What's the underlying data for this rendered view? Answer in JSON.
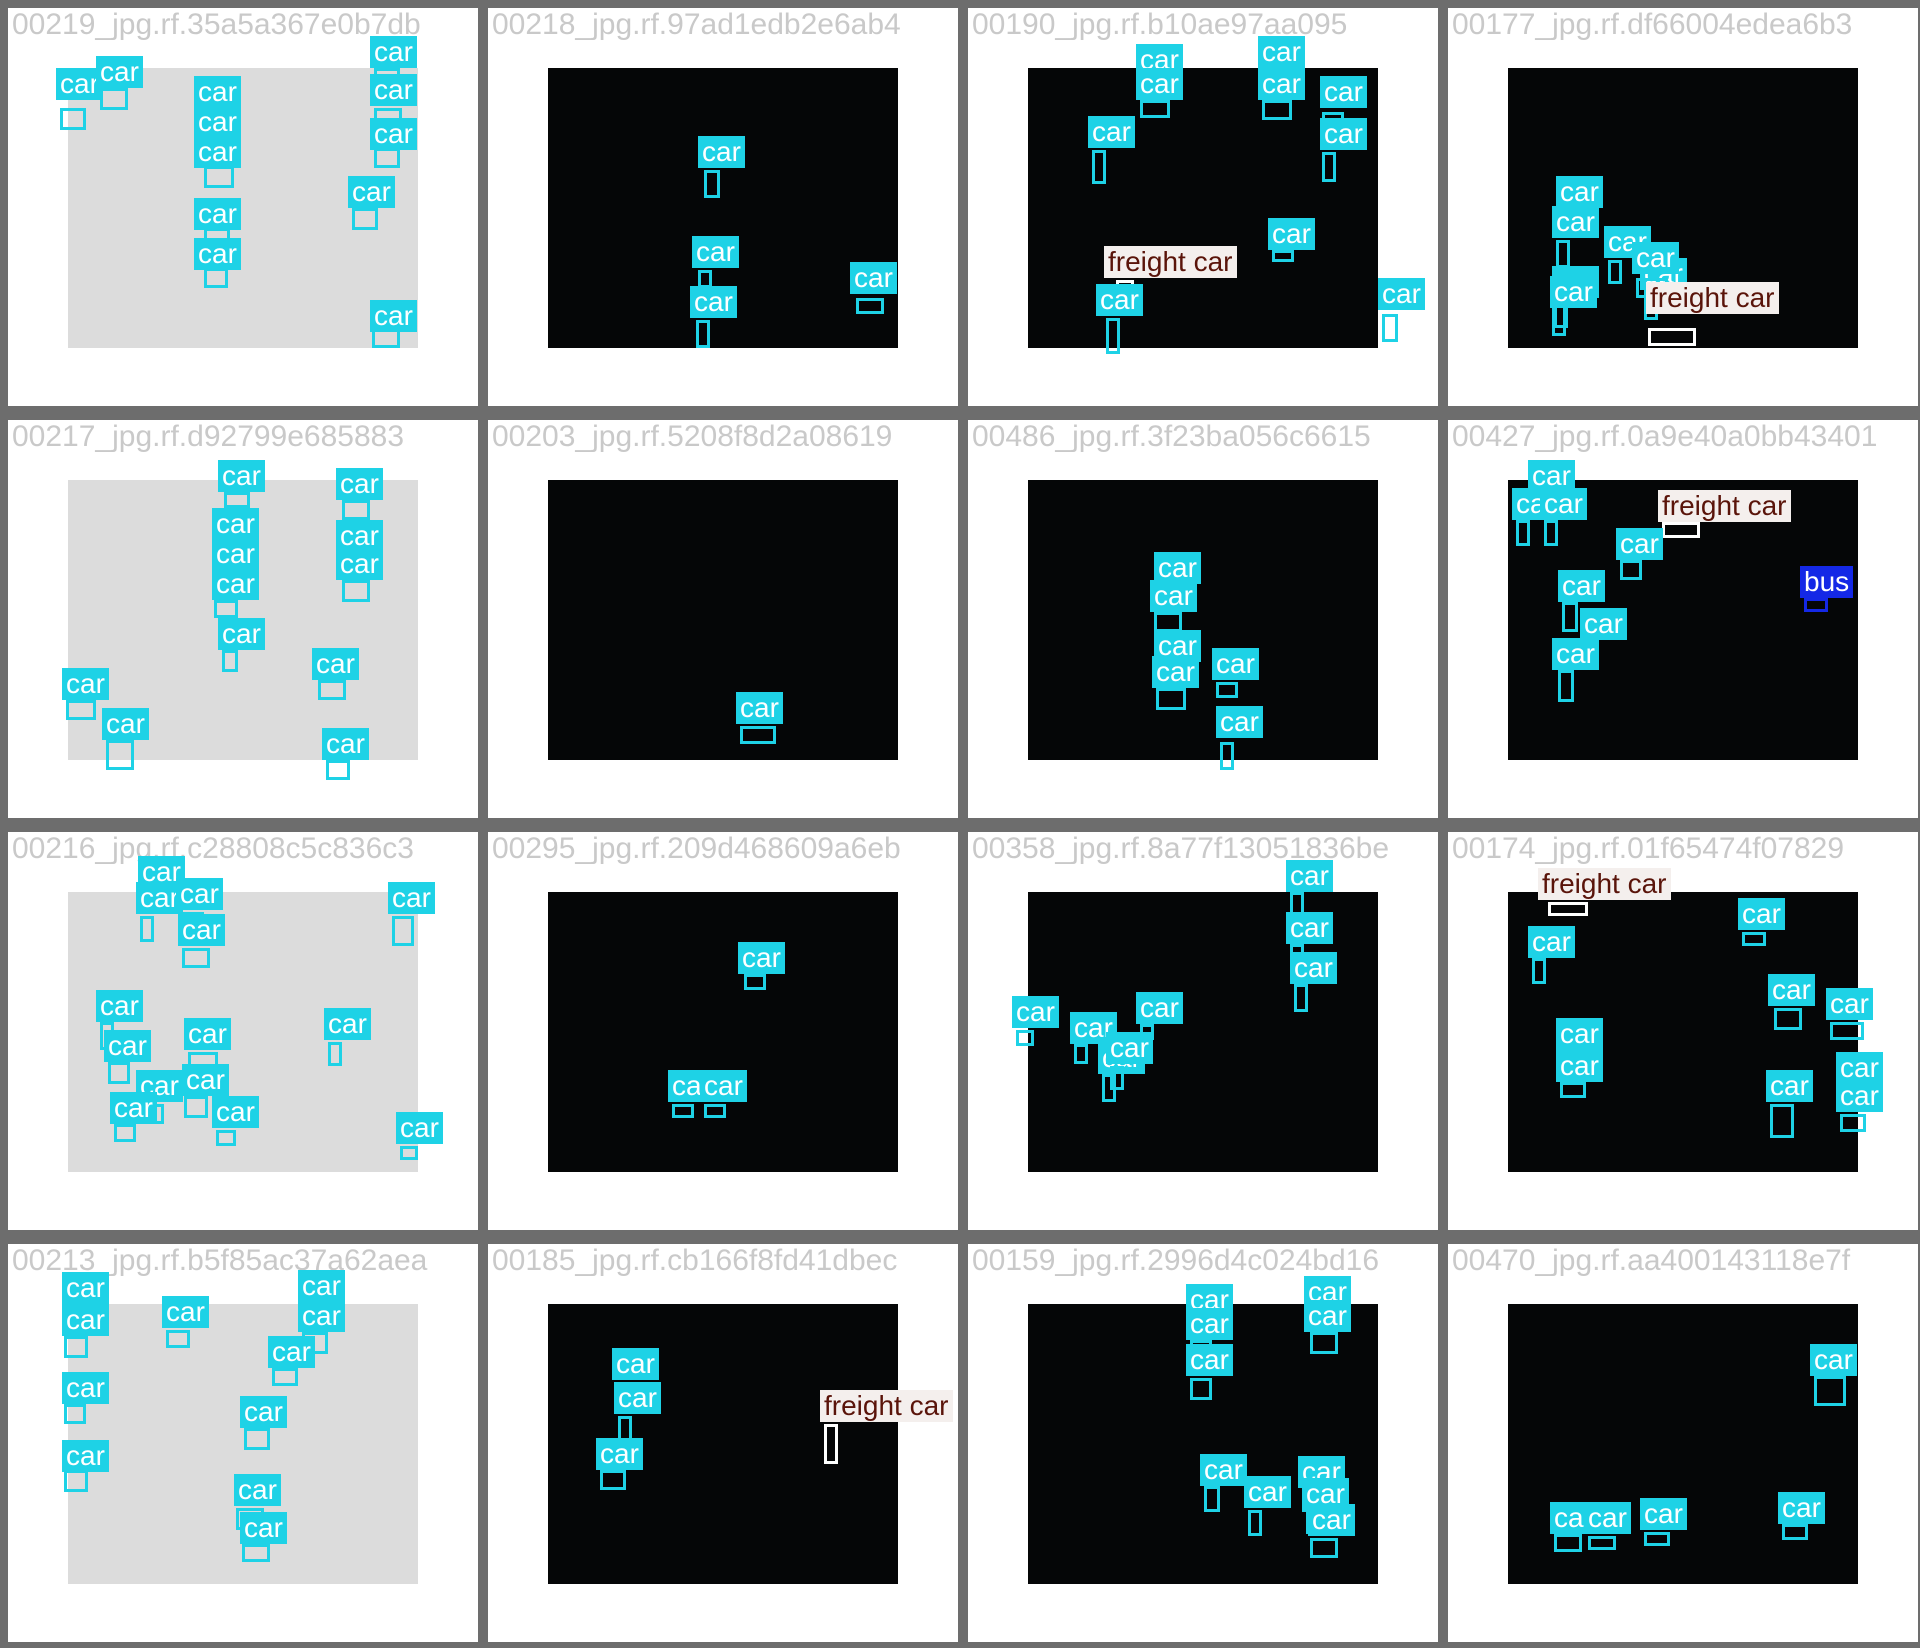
{
  "colors": {
    "car": "#1ed2e6",
    "freight_car": "#f4efed",
    "freight_car_text": "#5a140a",
    "bus": "#1428e6"
  },
  "cells": [
    {
      "caption": "00219_jpg.rf.35a5a367e0b7db",
      "scene": "day",
      "detections": [
        {
          "label": "car",
          "cls": "car"
        },
        {
          "label": "car",
          "cls": "car"
        },
        {
          "label": "car",
          "cls": "car"
        },
        {
          "label": "car",
          "cls": "car"
        },
        {
          "label": "car",
          "cls": "car"
        },
        {
          "label": "car",
          "cls": "car"
        },
        {
          "label": "car",
          "cls": "car"
        },
        {
          "label": "car",
          "cls": "car"
        },
        {
          "label": "car",
          "cls": "car"
        },
        {
          "label": "car",
          "cls": "car"
        },
        {
          "label": "car",
          "cls": "car"
        },
        {
          "label": "car",
          "cls": "car"
        }
      ]
    },
    {
      "caption": "00218_jpg.rf.97ad1edb2e6ab4",
      "scene": "night",
      "detections": [
        {
          "label": "car",
          "cls": "car"
        },
        {
          "label": "car",
          "cls": "car"
        },
        {
          "label": "car",
          "cls": "car"
        },
        {
          "label": "car",
          "cls": "car"
        }
      ]
    },
    {
      "caption": "00190_jpg.rf.b10ae97aa095",
      "scene": "night",
      "detections": [
        {
          "label": "car",
          "cls": "car"
        },
        {
          "label": "car",
          "cls": "car"
        },
        {
          "label": "car",
          "cls": "car"
        },
        {
          "label": "car",
          "cls": "car"
        },
        {
          "label": "car",
          "cls": "car"
        },
        {
          "label": "car",
          "cls": "car"
        },
        {
          "label": "car",
          "cls": "car"
        },
        {
          "label": "car",
          "cls": "car"
        },
        {
          "label": "freight car",
          "cls": "freight"
        },
        {
          "label": "car",
          "cls": "car"
        },
        {
          "label": "car",
          "cls": "car"
        }
      ]
    },
    {
      "caption": "00177_jpg.rf.df66004edea6b3",
      "scene": "night",
      "detections": [
        {
          "label": "car",
          "cls": "car"
        },
        {
          "label": "car",
          "cls": "car"
        },
        {
          "label": "car",
          "cls": "car"
        },
        {
          "label": "car",
          "cls": "car"
        },
        {
          "label": "car",
          "cls": "car"
        },
        {
          "label": "car",
          "cls": "car"
        },
        {
          "label": "car",
          "cls": "car"
        },
        {
          "label": "freight car",
          "cls": "freight"
        }
      ]
    },
    {
      "caption": "00217_jpg.rf.d92799e685883",
      "scene": "day",
      "detections": [
        {
          "label": "car",
          "cls": "car"
        },
        {
          "label": "car",
          "cls": "car"
        },
        {
          "label": "car",
          "cls": "car"
        },
        {
          "label": "car",
          "cls": "car"
        },
        {
          "label": "car",
          "cls": "car"
        },
        {
          "label": "car",
          "cls": "car"
        },
        {
          "label": "car",
          "cls": "car"
        },
        {
          "label": "car",
          "cls": "car"
        },
        {
          "label": "car",
          "cls": "car"
        },
        {
          "label": "car",
          "cls": "car"
        },
        {
          "label": "car",
          "cls": "car"
        },
        {
          "label": "car",
          "cls": "car"
        }
      ]
    },
    {
      "caption": "00203_jpg.rf.5208f8d2a08619",
      "scene": "night",
      "detections": [
        {
          "label": "car",
          "cls": "car"
        }
      ]
    },
    {
      "caption": "00486_jpg.rf.3f23ba056c6615",
      "scene": "night",
      "detections": [
        {
          "label": "car",
          "cls": "car"
        },
        {
          "label": "car",
          "cls": "car"
        },
        {
          "label": "car",
          "cls": "car"
        },
        {
          "label": "car",
          "cls": "car"
        },
        {
          "label": "car",
          "cls": "car"
        },
        {
          "label": "car",
          "cls": "car"
        }
      ]
    },
    {
      "caption": "00427_jpg.rf.0a9e40a0bb43401",
      "scene": "night",
      "detections": [
        {
          "label": "car",
          "cls": "car"
        },
        {
          "label": "car",
          "cls": "car"
        },
        {
          "label": "car",
          "cls": "car"
        },
        {
          "label": "freight car",
          "cls": "freight"
        },
        {
          "label": "car",
          "cls": "car"
        },
        {
          "label": "car",
          "cls": "car"
        },
        {
          "label": "car",
          "cls": "car"
        },
        {
          "label": "bus",
          "cls": "bus"
        },
        {
          "label": "car",
          "cls": "car"
        }
      ]
    },
    {
      "caption": "00216_jpg.rf.c28808c5c836c3",
      "scene": "day",
      "detections": [
        {
          "label": "car",
          "cls": "car"
        },
        {
          "label": "car",
          "cls": "car"
        },
        {
          "label": "car",
          "cls": "car"
        },
        {
          "label": "car",
          "cls": "car"
        },
        {
          "label": "car",
          "cls": "car"
        },
        {
          "label": "car",
          "cls": "car"
        },
        {
          "label": "car",
          "cls": "car"
        },
        {
          "label": "car",
          "cls": "car"
        },
        {
          "label": "car",
          "cls": "car"
        },
        {
          "label": "car",
          "cls": "car"
        },
        {
          "label": "car",
          "cls": "car"
        },
        {
          "label": "car",
          "cls": "car"
        },
        {
          "label": "car",
          "cls": "car"
        },
        {
          "label": "car",
          "cls": "car"
        }
      ]
    },
    {
      "caption": "00295_jpg.rf.209d468609a6eb",
      "scene": "night",
      "detections": [
        {
          "label": "car",
          "cls": "car"
        },
        {
          "label": "car",
          "cls": "car"
        },
        {
          "label": "car",
          "cls": "car"
        }
      ]
    },
    {
      "caption": "00358_jpg.rf.8a77f13051836be",
      "scene": "night",
      "detections": [
        {
          "label": "car",
          "cls": "car"
        },
        {
          "label": "car",
          "cls": "car"
        },
        {
          "label": "car",
          "cls": "car"
        },
        {
          "label": "car",
          "cls": "car"
        },
        {
          "label": "car",
          "cls": "car"
        },
        {
          "label": "car",
          "cls": "car"
        },
        {
          "label": "car",
          "cls": "car"
        },
        {
          "label": "car",
          "cls": "car"
        }
      ]
    },
    {
      "caption": "00174_jpg.rf.01f65474f07829",
      "scene": "night",
      "detections": [
        {
          "label": "freight car",
          "cls": "freight"
        },
        {
          "label": "car",
          "cls": "car"
        },
        {
          "label": "car",
          "cls": "car"
        },
        {
          "label": "car",
          "cls": "car"
        },
        {
          "label": "car",
          "cls": "car"
        },
        {
          "label": "car",
          "cls": "car"
        },
        {
          "label": "car",
          "cls": "car"
        },
        {
          "label": "car",
          "cls": "car"
        },
        {
          "label": "car",
          "cls": "car"
        },
        {
          "label": "car",
          "cls": "car"
        }
      ]
    },
    {
      "caption": "00213_jpg.rf.b5f85ac37a62aea",
      "scene": "day",
      "detections": [
        {
          "label": "car",
          "cls": "car"
        },
        {
          "label": "car",
          "cls": "car"
        },
        {
          "label": "car",
          "cls": "car"
        },
        {
          "label": "car",
          "cls": "car"
        },
        {
          "label": "car",
          "cls": "car"
        },
        {
          "label": "car",
          "cls": "car"
        },
        {
          "label": "car",
          "cls": "car"
        },
        {
          "label": "car",
          "cls": "car"
        },
        {
          "label": "car",
          "cls": "car"
        },
        {
          "label": "car",
          "cls": "car"
        },
        {
          "label": "car",
          "cls": "car"
        }
      ]
    },
    {
      "caption": "00185_jpg.rf.cb166f8fd41dbec",
      "scene": "night",
      "detections": [
        {
          "label": "car",
          "cls": "car"
        },
        {
          "label": "car",
          "cls": "car"
        },
        {
          "label": "car",
          "cls": "car"
        },
        {
          "label": "freight car",
          "cls": "freight"
        }
      ]
    },
    {
      "caption": "00159_jpg.rf.2996d4c024bd16",
      "scene": "night",
      "detections": [
        {
          "label": "car",
          "cls": "car"
        },
        {
          "label": "car",
          "cls": "car"
        },
        {
          "label": "car",
          "cls": "car"
        },
        {
          "label": "car",
          "cls": "car"
        },
        {
          "label": "car",
          "cls": "car"
        },
        {
          "label": "car",
          "cls": "car"
        },
        {
          "label": "car",
          "cls": "car"
        },
        {
          "label": "car",
          "cls": "car"
        },
        {
          "label": "car",
          "cls": "car"
        },
        {
          "label": "car",
          "cls": "car"
        }
      ]
    },
    {
      "caption": "00470_jpg.rf.aa400143118e7f",
      "scene": "night",
      "detections": [
        {
          "label": "car",
          "cls": "car"
        },
        {
          "label": "car",
          "cls": "car"
        },
        {
          "label": "car",
          "cls": "car"
        },
        {
          "label": "car",
          "cls": "car"
        },
        {
          "label": "car",
          "cls": "car"
        }
      ]
    }
  ]
}
